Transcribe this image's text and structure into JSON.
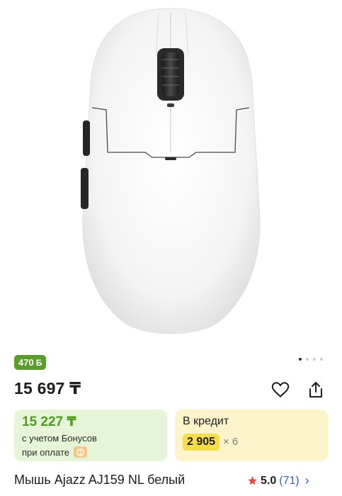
{
  "product": {
    "bonus_badge": "470",
    "bonus_badge_symbol": "Б",
    "gallery": {
      "total": 4,
      "active": 0
    },
    "price": "15 697 ₸",
    "title": "Мышь Ajazz AJ159 NL белый"
  },
  "bonus_card": {
    "price": "15 227 ₸",
    "note_line1": "с учетом Бонусов",
    "note_line2": "при оплате"
  },
  "credit_card": {
    "title": "В кредит",
    "amount": "2 905",
    "multiplier": "× 6"
  },
  "rating": {
    "score": "5.0",
    "count": "(71)",
    "chevron": "›"
  },
  "colors": {
    "bonus_green": "#5a9c2d",
    "bonus_card_bg": "#e6f4d8",
    "credit_card_bg": "#fdf4cc",
    "credit_highlight": "#f7dc4b",
    "star": "#e8493c",
    "link": "#3a63b8"
  },
  "icons": [
    "heart-icon",
    "share-icon",
    "star-icon",
    "chevron-right-icon",
    "payment-icon"
  ]
}
